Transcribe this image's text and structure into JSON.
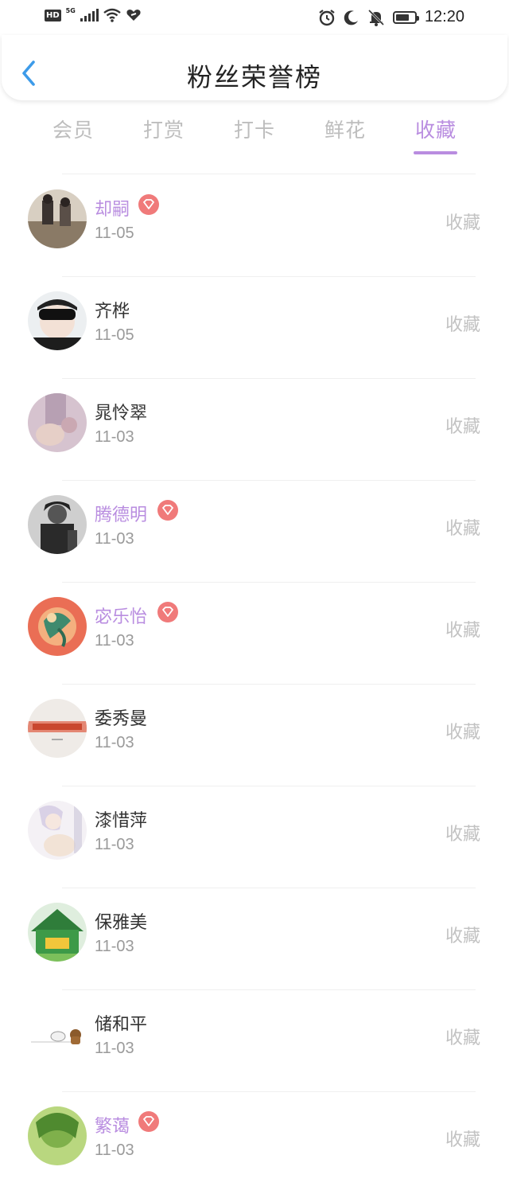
{
  "status_bar": {
    "hd": "HD",
    "network": "5G",
    "time": "12:20",
    "icons": [
      "signal-icon",
      "wifi-icon",
      "heart-link-icon",
      "alarm-icon",
      "moon-icon",
      "bell-off-icon",
      "battery-icon"
    ]
  },
  "header": {
    "title": "粉丝荣誉榜",
    "back_icon": "chevron-left-icon"
  },
  "tabs": [
    {
      "label": "会员",
      "active": false
    },
    {
      "label": "打赏",
      "active": false
    },
    {
      "label": "打卡",
      "active": false
    },
    {
      "label": "鲜花",
      "active": false
    },
    {
      "label": "收藏",
      "active": true
    }
  ],
  "colors": {
    "accent": "#b98de0",
    "badge": "#f07a7a",
    "muted": "#9a9a9a",
    "action": "#c2c2c2"
  },
  "list": {
    "action_label": "收藏",
    "items": [
      {
        "name": "却嗣",
        "date": "11-05",
        "vip": true
      },
      {
        "name": "齐桦",
        "date": "11-05",
        "vip": false
      },
      {
        "name": "晁怜翠",
        "date": "11-03",
        "vip": false
      },
      {
        "name": "腾德明",
        "date": "11-03",
        "vip": true
      },
      {
        "name": "宓乐怡",
        "date": "11-03",
        "vip": true
      },
      {
        "name": "委秀曼",
        "date": "11-03",
        "vip": false
      },
      {
        "name": "漆惜萍",
        "date": "11-03",
        "vip": false
      },
      {
        "name": "保雅美",
        "date": "11-03",
        "vip": false
      },
      {
        "name": "储和平",
        "date": "11-03",
        "vip": false
      },
      {
        "name": "繁蔼",
        "date": "11-03",
        "vip": true
      }
    ]
  }
}
